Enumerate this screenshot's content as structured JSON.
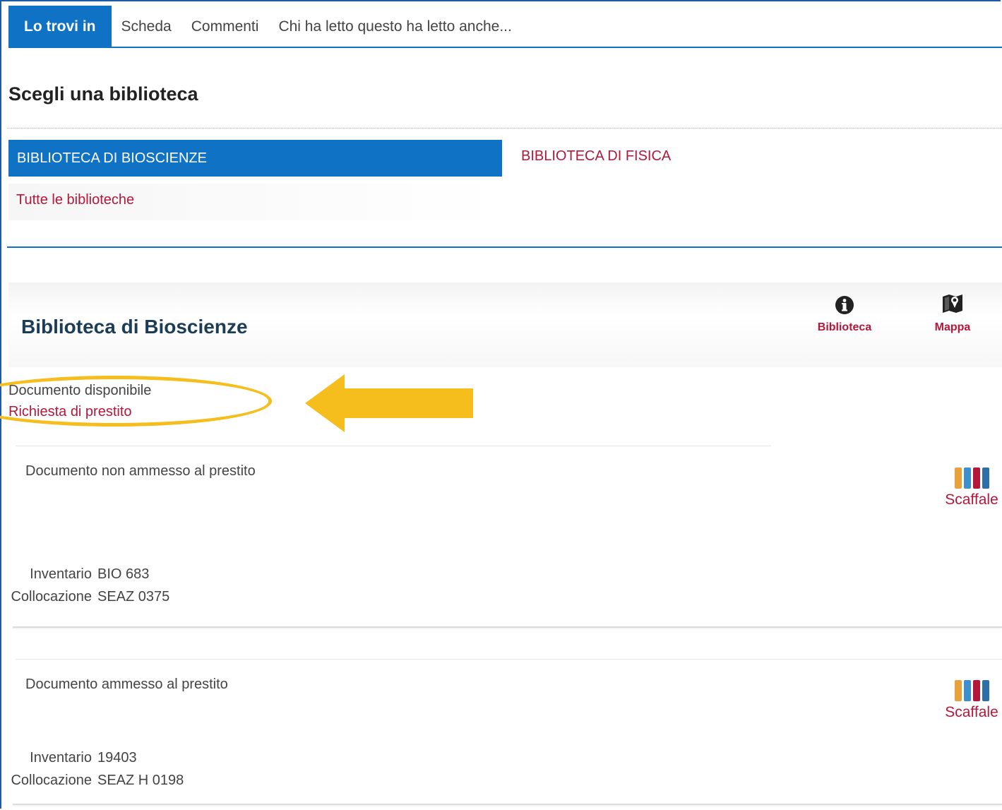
{
  "tabs": [
    {
      "label": "Lo trovi in",
      "active": true
    },
    {
      "label": "Scheda",
      "active": false
    },
    {
      "label": "Commenti",
      "active": false
    },
    {
      "label": "Chi ha letto questo ha letto anche...",
      "active": false
    }
  ],
  "choose": {
    "title": "Scegli una biblioteca",
    "libraries": [
      "BIBLIOTECA DI BIOSCIENZE",
      "BIBLIOTECA DI FISICA"
    ],
    "all_label": "Tutte le biblioteche"
  },
  "library": {
    "name": "Biblioteca di Bioscienze",
    "info_label": "Biblioteca",
    "info_icon": "info-icon",
    "map_label": "Mappa",
    "map_icon": "map-icon",
    "availability": "Documento disponibile",
    "loan_request": "Richiesta di prestito"
  },
  "items": [
    {
      "status": "Documento non ammesso al prestito",
      "shelf_label": "Scaffale",
      "inventory_label": "Inventario",
      "inventory": "BIO 683",
      "location_label": "Collocazione",
      "location": "SEAZ 0375"
    },
    {
      "status": "Documento ammesso al prestito",
      "shelf_label": "Scaffale",
      "inventory_label": "Inventario",
      "inventory": "19403",
      "location_label": "Collocazione",
      "location": "SEAZ H 0198"
    }
  ],
  "colors": {
    "primary": "#0f72c4",
    "link": "#b5173a",
    "highlight": "#f5be1c",
    "shelf_books": [
      "#e8a23c",
      "#3d8fd0",
      "#b5173a",
      "#2f6fa8"
    ]
  }
}
